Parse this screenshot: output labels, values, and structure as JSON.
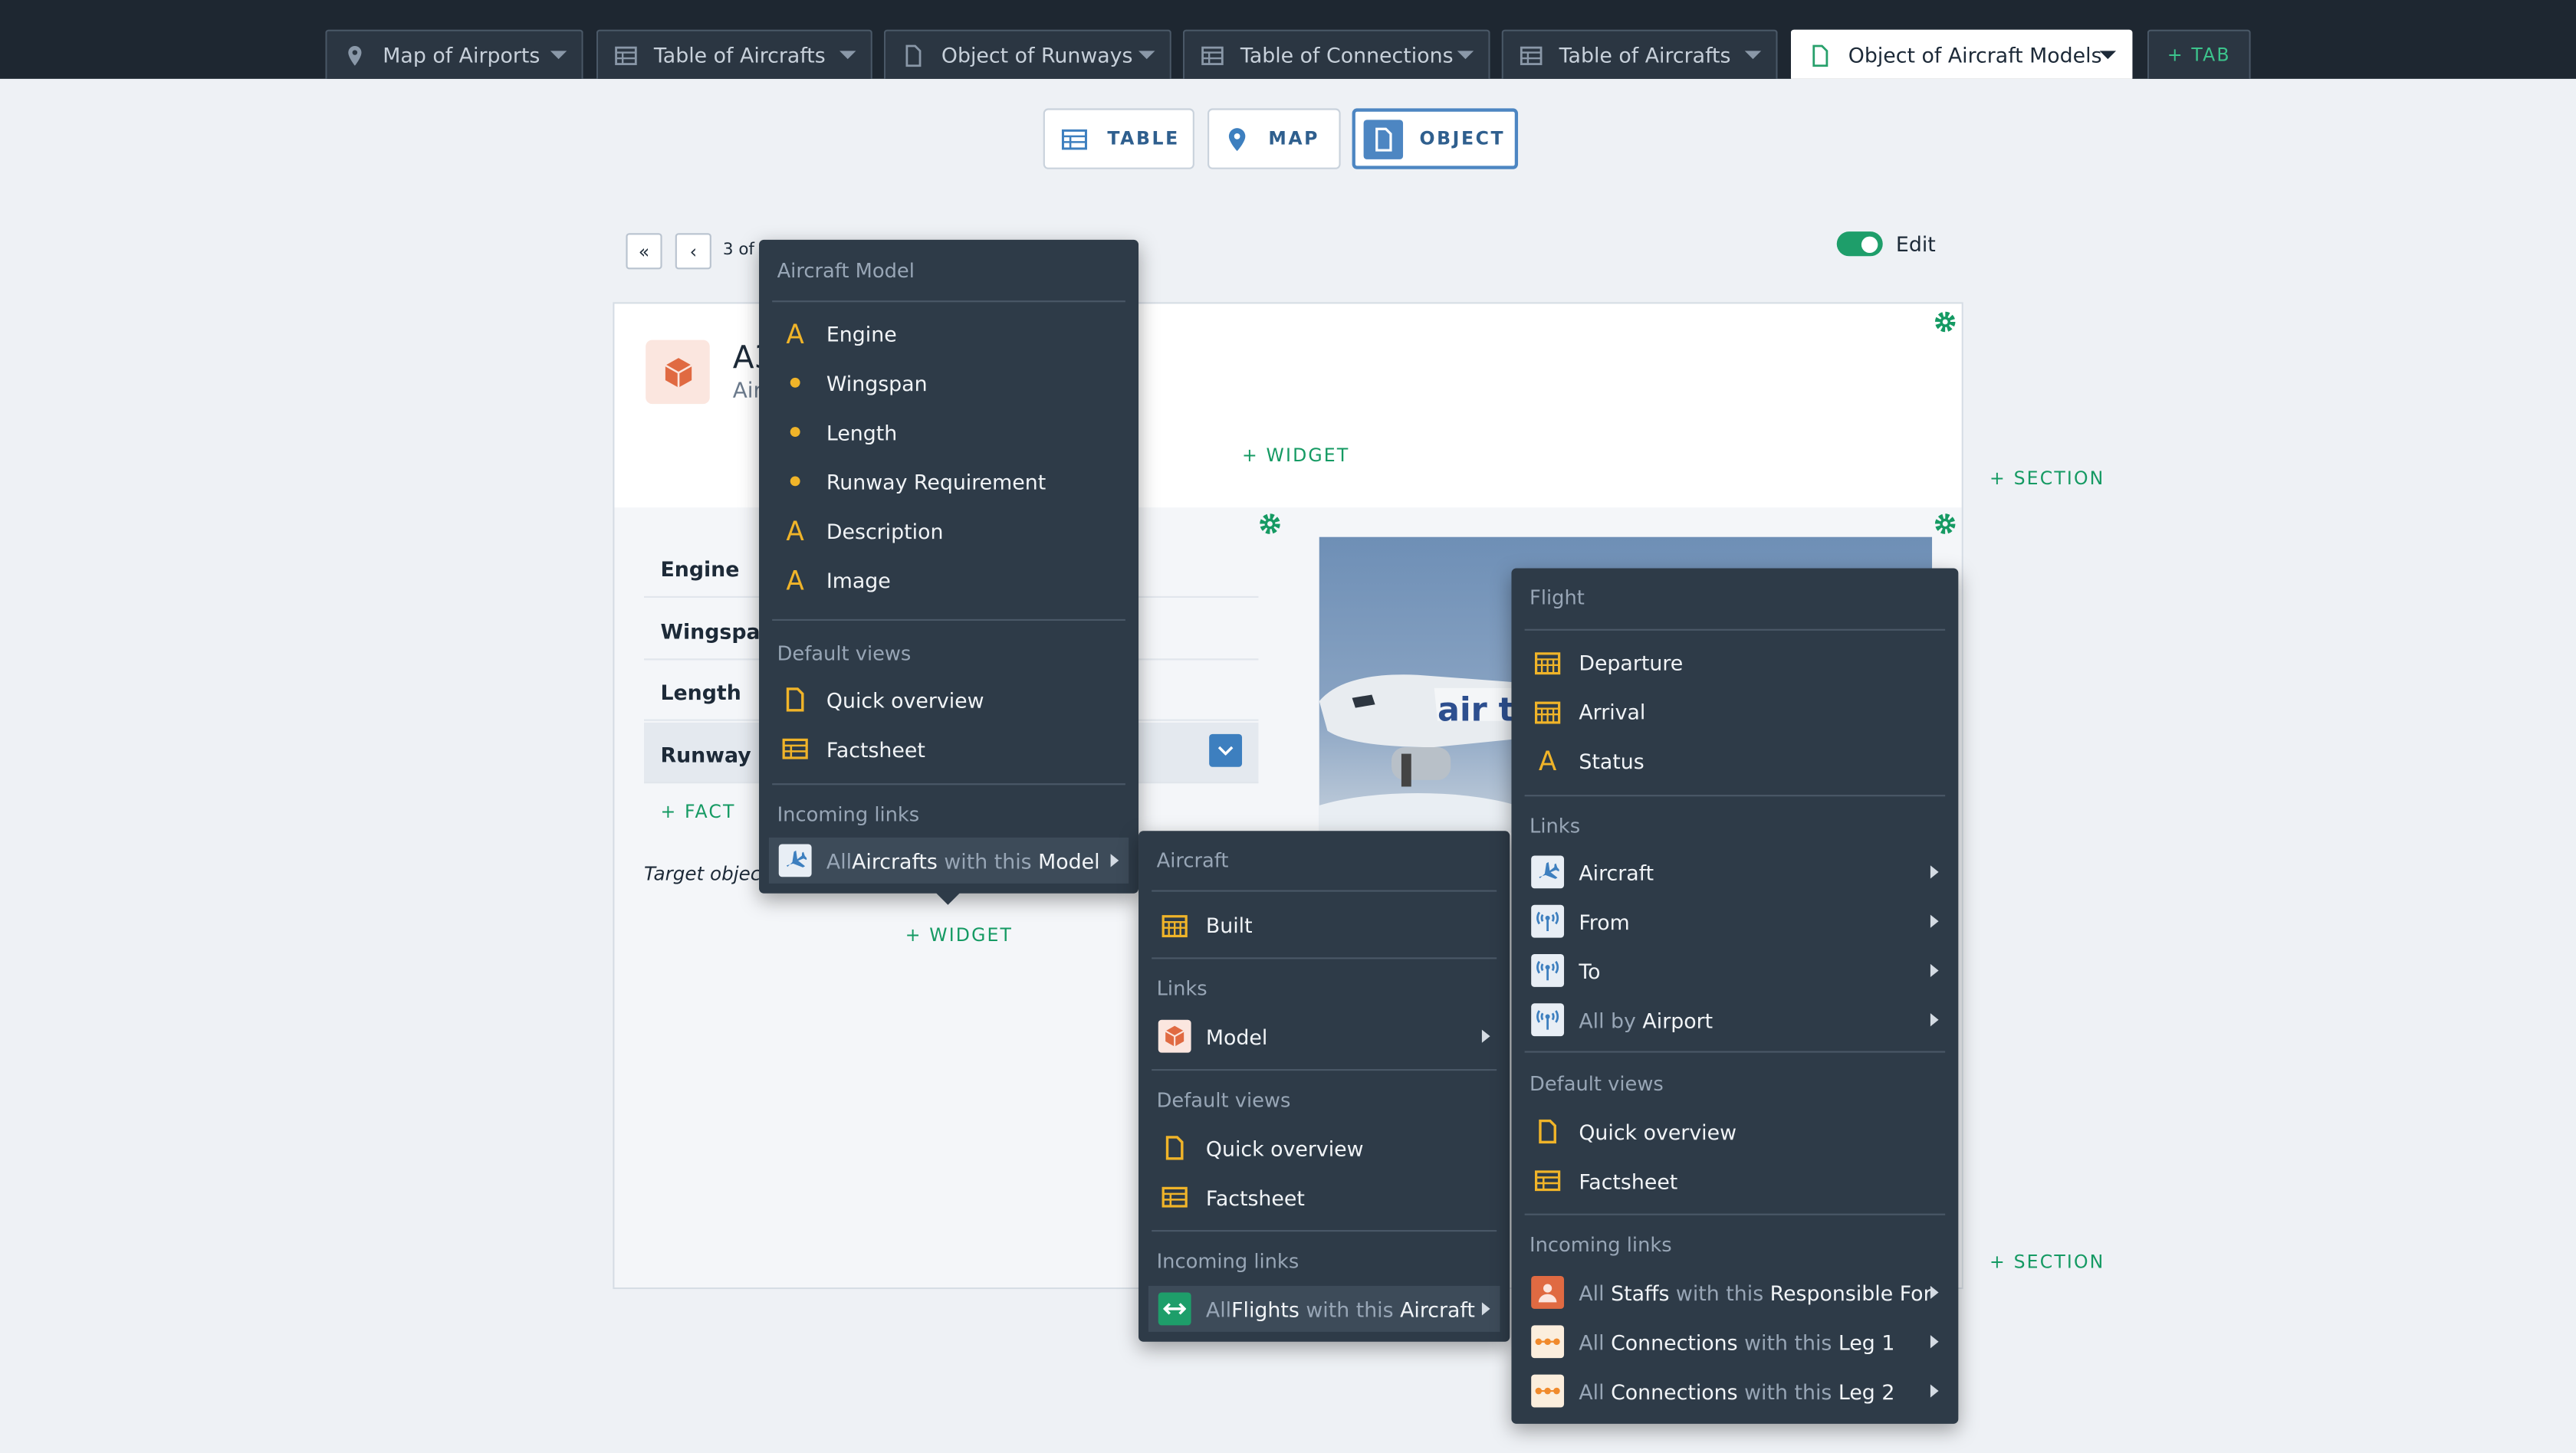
{
  "tabs": [
    {
      "label": "Map of Airports",
      "icon": "map-pin-icon"
    },
    {
      "label": "Table of Aircrafts",
      "icon": "table-icon"
    },
    {
      "label": "Object of Runways",
      "icon": "document-icon"
    },
    {
      "label": "Table of Connections",
      "icon": "table-icon"
    },
    {
      "label": "Table of Aircrafts",
      "icon": "table-icon"
    },
    {
      "label": "Object of Aircraft Models",
      "icon": "document-icon",
      "active": true
    }
  ],
  "add_tab_label": "+ TAB",
  "view_switch": {
    "table": "TABLE",
    "map": "MAP",
    "object": "OBJECT",
    "active": "OBJECT"
  },
  "pager": {
    "text": "3 of 1"
  },
  "edit": {
    "label": "Edit",
    "on": true
  },
  "object": {
    "title": "A3",
    "subtitle": "Air"
  },
  "facts": [
    {
      "label": "Engine"
    },
    {
      "label": "Wingspan"
    },
    {
      "label": "Length"
    },
    {
      "label": "Runway Re"
    }
  ],
  "add_fact": "+ FACT",
  "target_text": "Target object",
  "add_widget": "+ WIDGET",
  "add_section": "+ SECTION",
  "menu_model": {
    "header": "Aircraft Model",
    "properties": [
      {
        "label": "Engine",
        "icon": "text-A-icon"
      },
      {
        "label": "Wingspan",
        "icon": "dot-icon"
      },
      {
        "label": "Length",
        "icon": "dot-icon"
      },
      {
        "label": "Runway Requirement",
        "icon": "dot-icon"
      },
      {
        "label": "Description",
        "icon": "text-A-icon"
      },
      {
        "label": "Image",
        "icon": "text-A-icon"
      }
    ],
    "default_views_header": "Default views",
    "default_views": [
      {
        "label": "Quick overview",
        "icon": "document-icon"
      },
      {
        "label": "Factsheet",
        "icon": "table-icon"
      }
    ],
    "incoming_header": "Incoming links",
    "incoming": [
      {
        "pre": "All ",
        "obj": "Aircrafts",
        "mid": " with this ",
        "link": "Model"
      }
    ]
  },
  "menu_aircraft": {
    "header": "Aircraft",
    "properties": [
      {
        "label": "Built",
        "icon": "calendar-icon"
      }
    ],
    "links_header": "Links",
    "links": [
      {
        "label": "Model",
        "icon": "cube-icon"
      }
    ],
    "default_views_header": "Default views",
    "default_views": [
      {
        "label": "Quick overview",
        "icon": "document-icon"
      },
      {
        "label": "Factsheet",
        "icon": "table-icon"
      }
    ],
    "incoming_header": "Incoming links",
    "incoming": [
      {
        "pre": "All ",
        "obj": "Flights",
        "mid": " with this ",
        "link": "Aircraft"
      }
    ]
  },
  "menu_flight": {
    "header": "Flight",
    "properties": [
      {
        "label": "Departure",
        "icon": "calendar-icon"
      },
      {
        "label": "Arrival",
        "icon": "calendar-icon"
      },
      {
        "label": "Status",
        "icon": "text-A-icon"
      }
    ],
    "links_header": "Links",
    "links": [
      {
        "label": "Aircraft",
        "icon": "airplane-icon"
      },
      {
        "label": "From",
        "icon": "antenna-icon"
      },
      {
        "label": "To",
        "icon": "antenna-icon"
      }
    ],
    "links_all": {
      "pre": "All by ",
      "obj": "Airport"
    },
    "default_views_header": "Default views",
    "default_views": [
      {
        "label": "Quick overview",
        "icon": "document-icon"
      },
      {
        "label": "Factsheet",
        "icon": "table-icon"
      }
    ],
    "incoming_header": "Incoming links",
    "incoming": [
      {
        "pre": "All ",
        "obj": "Staffs",
        "mid": " with this ",
        "link": "Responsible For"
      },
      {
        "pre": "All ",
        "obj": "Connections",
        "mid": " with this ",
        "link": "Leg 1"
      },
      {
        "pre": "All ",
        "obj": "Connections",
        "mid": " with this ",
        "link": "Leg 2"
      }
    ]
  },
  "colors": {
    "accent_green": "#159a63",
    "menu_bg": "#2e3b48",
    "icon_yellow": "#f0b429",
    "object_blue": "#4d86c2",
    "cube_orange": "#e06a42"
  }
}
